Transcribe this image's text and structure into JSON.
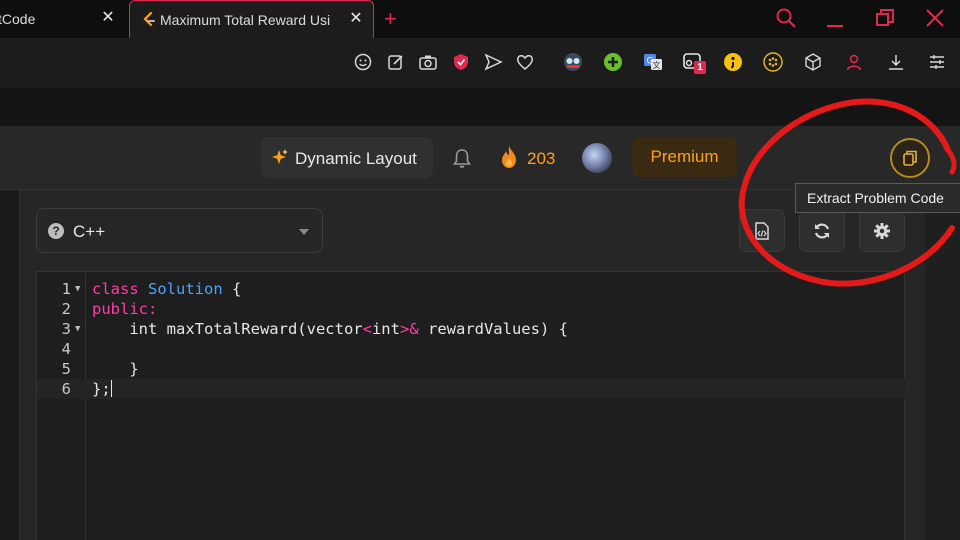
{
  "browser": {
    "tabs": [
      {
        "label": "tCode",
        "active": false
      },
      {
        "label": "Maximum Total Reward Usi",
        "active": true
      }
    ],
    "new_tab_label": "+",
    "accent_color": "#e0294f",
    "toolbar_icons": [
      "emoji-icon",
      "edit-icon",
      "camera-icon",
      "shield-icon",
      "send-icon",
      "heart-icon",
      "glasses-extension-icon",
      "plus-extension-icon",
      "translate-icon",
      "badge-extension-icon",
      "semicolon-extension-icon",
      "dots-extension-icon",
      "cube-icon",
      "profile-icon",
      "download-icon",
      "settings-sliders-icon"
    ],
    "badge_count": "1"
  },
  "header": {
    "dynamic_layout_label": "Dynamic Layout",
    "streak_count": "203",
    "premium_label": "Premium",
    "brand_color": "#ffa116"
  },
  "editor": {
    "language": "C++",
    "lines": [
      {
        "num": "1",
        "fold": true
      },
      {
        "num": "2",
        "fold": false
      },
      {
        "num": "3",
        "fold": true
      },
      {
        "num": "4",
        "fold": false
      },
      {
        "num": "5",
        "fold": false
      },
      {
        "num": "6",
        "fold": false
      }
    ],
    "code": {
      "l1_kw": "class",
      "l1_cls": "Solution",
      "l1_rest": " {",
      "l2_kw": "public:",
      "l3_a": "    int maxTotalReward(vector",
      "l3_lt": "<",
      "l3_int": "int",
      "l3_gt": ">",
      "l3_amp": "&",
      "l3_b": " rewardValues) {",
      "l4": "",
      "l5": "    }",
      "l6": "};"
    }
  },
  "tooltip": {
    "text": "Extract Problem Code"
  }
}
